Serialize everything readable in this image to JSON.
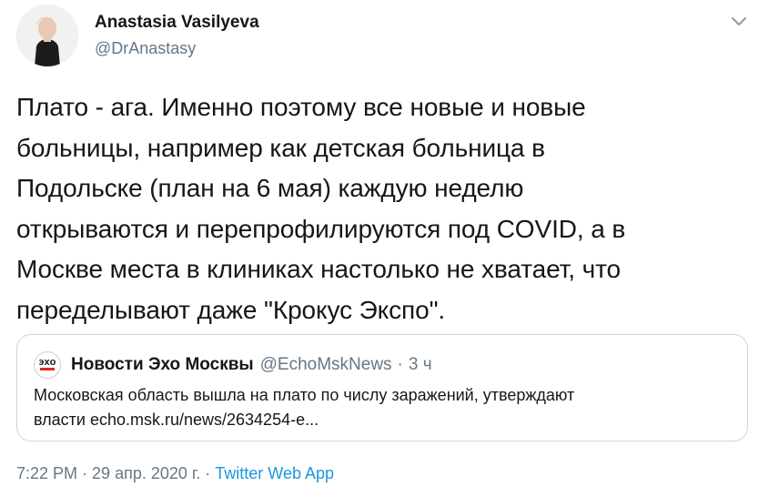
{
  "author": {
    "display_name": "Anastasia Vasilyeva",
    "handle": "@DrAnastasy"
  },
  "tweet": {
    "lines": [
      "Плато - ага. Именно поэтому все новые и новые",
      "больницы, например как детская больница в",
      "Подольске (план на 6 мая) каждую неделю",
      "открываются и перепрофилируются под COVID, а в",
      "Москве места в клиниках настолько не хватает, что",
      "переделывают даже \"Крокус Экспо\"."
    ]
  },
  "quote": {
    "avatar_text": "ЭХО",
    "name": "Новости Эхо Москвы",
    "handle": "@EchoMskNews",
    "separator": "·",
    "time": "3 ч",
    "lines": [
      "Московская область вышла на плато по числу заражений, утверждают",
      "власти echo.msk.ru/news/2634254-e..."
    ]
  },
  "footer": {
    "time": "7:22 PM",
    "separator1": " · ",
    "date": "29 апр. 2020 г.",
    "separator2": " · ",
    "source": "Twitter Web App"
  },
  "colors": {
    "text": "#14171a",
    "secondary": "#657786",
    "link": "#1b95e0",
    "border": "#ccd6dd",
    "echo_red": "#e0281f"
  },
  "icons": {
    "caret": "chevron-down-icon",
    "avatar": "profile-photo",
    "quote_avatar": "echo-logo"
  }
}
